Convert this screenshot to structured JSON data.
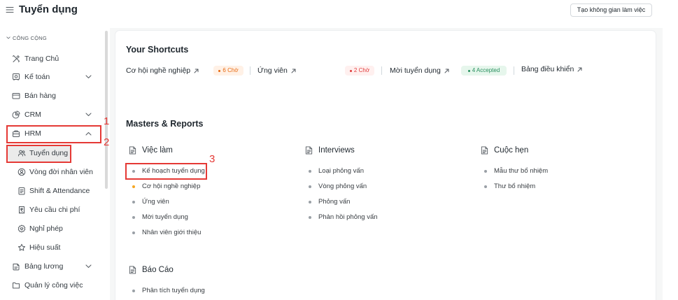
{
  "app": {
    "title": "Tuyển dụng",
    "create_workspace_label": "Tạo không gian làm việc"
  },
  "sidebar": {
    "section_label": "CÔNG CỘNG",
    "items": [
      {
        "label": "Trang Chủ",
        "icon": "tools-icon"
      },
      {
        "label": "Kế toán",
        "icon": "safe-icon",
        "chevron": "chevron-down-icon"
      },
      {
        "label": "Bán hàng",
        "icon": "pos-icon"
      },
      {
        "label": "CRM",
        "icon": "crm-icon",
        "chevron": "chevron-down-icon"
      },
      {
        "label": "HRM",
        "icon": "briefcase-icon",
        "chevron": "chevron-up-icon",
        "children": [
          {
            "label": "Tuyển dụng",
            "icon": "users-icon",
            "selected": true
          },
          {
            "label": "Vòng đời nhân viên",
            "icon": "user-circle-icon"
          },
          {
            "label": "Shift & Attendance",
            "icon": "clipboard-icon"
          },
          {
            "label": "Yêu cầu chi phí",
            "icon": "receipt-icon"
          },
          {
            "label": "Nghỉ phép",
            "icon": "heart-badge-icon"
          },
          {
            "label": "Hiệu suất",
            "icon": "star-icon"
          }
        ]
      },
      {
        "label": "Bảng lương",
        "icon": "payroll-icon",
        "chevron": "chevron-down-icon"
      },
      {
        "label": "Quản lý công việc",
        "icon": "folder-icon"
      }
    ]
  },
  "shortcuts": {
    "title": "Your Shortcuts",
    "items": [
      {
        "label": "Cơ hội nghề nghiệp",
        "badge": "6 Chờ",
        "badge_color": "#e8680f",
        "badge_bg": "#fff1e6"
      },
      {
        "label": "Ứng viên",
        "badge": "2 Chờ",
        "badge_color": "#e03b3b",
        "badge_bg": "#fff0ef"
      },
      {
        "label": "Mời tuyển dụng",
        "badge": "4 Accepted",
        "badge_color": "#278f5e",
        "badge_bg": "#e6f6ec"
      },
      {
        "label": "Bảng điều khiển"
      }
    ]
  },
  "masters": {
    "title": "Masters & Reports",
    "cards": [
      {
        "title": "Việc làm",
        "links": [
          {
            "label": "Kế hoạch tuyển dụng"
          },
          {
            "label": "Cơ hội nghề nghiệp",
            "indicator": "#f5a623"
          },
          {
            "label": "Ứng viên"
          },
          {
            "label": "Mời tuyển dụng"
          },
          {
            "label": "Nhân viên giới thiệu"
          }
        ]
      },
      {
        "title": "Interviews",
        "links": [
          {
            "label": "Loại phỏng vấn"
          },
          {
            "label": "Vòng phỏng vấn"
          },
          {
            "label": "Phỏng vấn"
          },
          {
            "label": "Phản hồi phỏng vấn"
          }
        ]
      },
      {
        "title": "Cuộc hẹn",
        "links": [
          {
            "label": "Mẫu thư bổ nhiệm"
          },
          {
            "label": "Thư bổ nhiệm"
          }
        ]
      },
      {
        "title": "Báo Cáo",
        "links": [
          {
            "label": "Phân tích tuyển dụng"
          }
        ]
      }
    ]
  },
  "annotations": {
    "color": "#e53935",
    "items": [
      {
        "label": "1"
      },
      {
        "label": "2"
      },
      {
        "label": "3"
      }
    ]
  }
}
